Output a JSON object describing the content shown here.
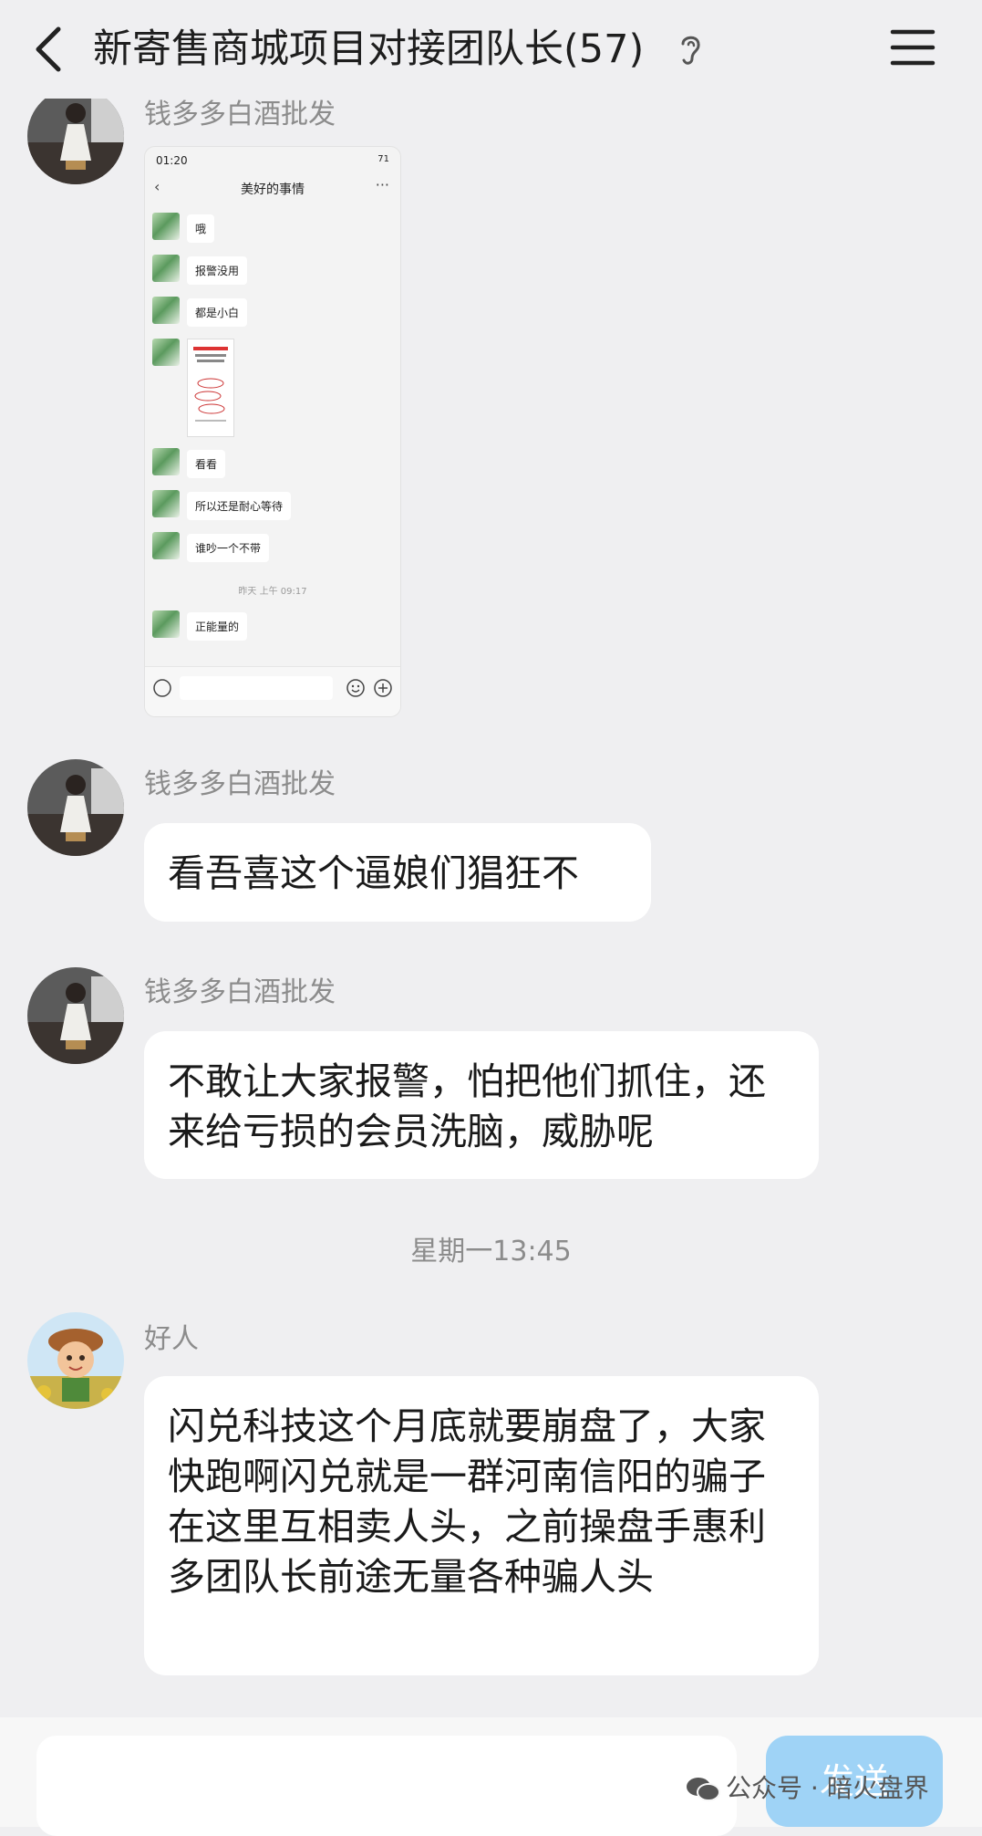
{
  "header": {
    "title": "新寄售商城项目对接团队长(57)"
  },
  "messages": [
    {
      "sender": "钱多多白酒批发"
    },
    {
      "sender": "钱多多白酒批发",
      "text": "看吾喜这个逼娘们猖狂不"
    },
    {
      "sender": "钱多多白酒批发",
      "text": "不敢让大家报警，怕把他们抓住，还来给亏损的会员洗脑，威胁呢"
    },
    {
      "sender": "好人",
      "text": "闪兑科技这个月底就要崩盘了，大家快跑啊闪兑就是一群河南信阳的骗子在这里互相卖人头，之前操盘手惠利多团队长前途无量各种骗人头"
    }
  ],
  "timestamp": "星期一13:45",
  "screenshot": {
    "status_time": "01:20",
    "status_battery": "71",
    "title": "美好的事情",
    "messages": [
      "哦",
      "报警没用",
      "都是小白",
      "看看",
      "所以还是耐心等待",
      "谁吵一个不带",
      "正能量的"
    ],
    "time": "昨天 上午 09:17"
  },
  "input": {
    "send_label": "发送"
  },
  "watermark": "公众号 · 暗火盘界",
  "colors": {
    "background": "#efeff1",
    "bubble": "#ffffff",
    "send": "#9fd3f6"
  }
}
